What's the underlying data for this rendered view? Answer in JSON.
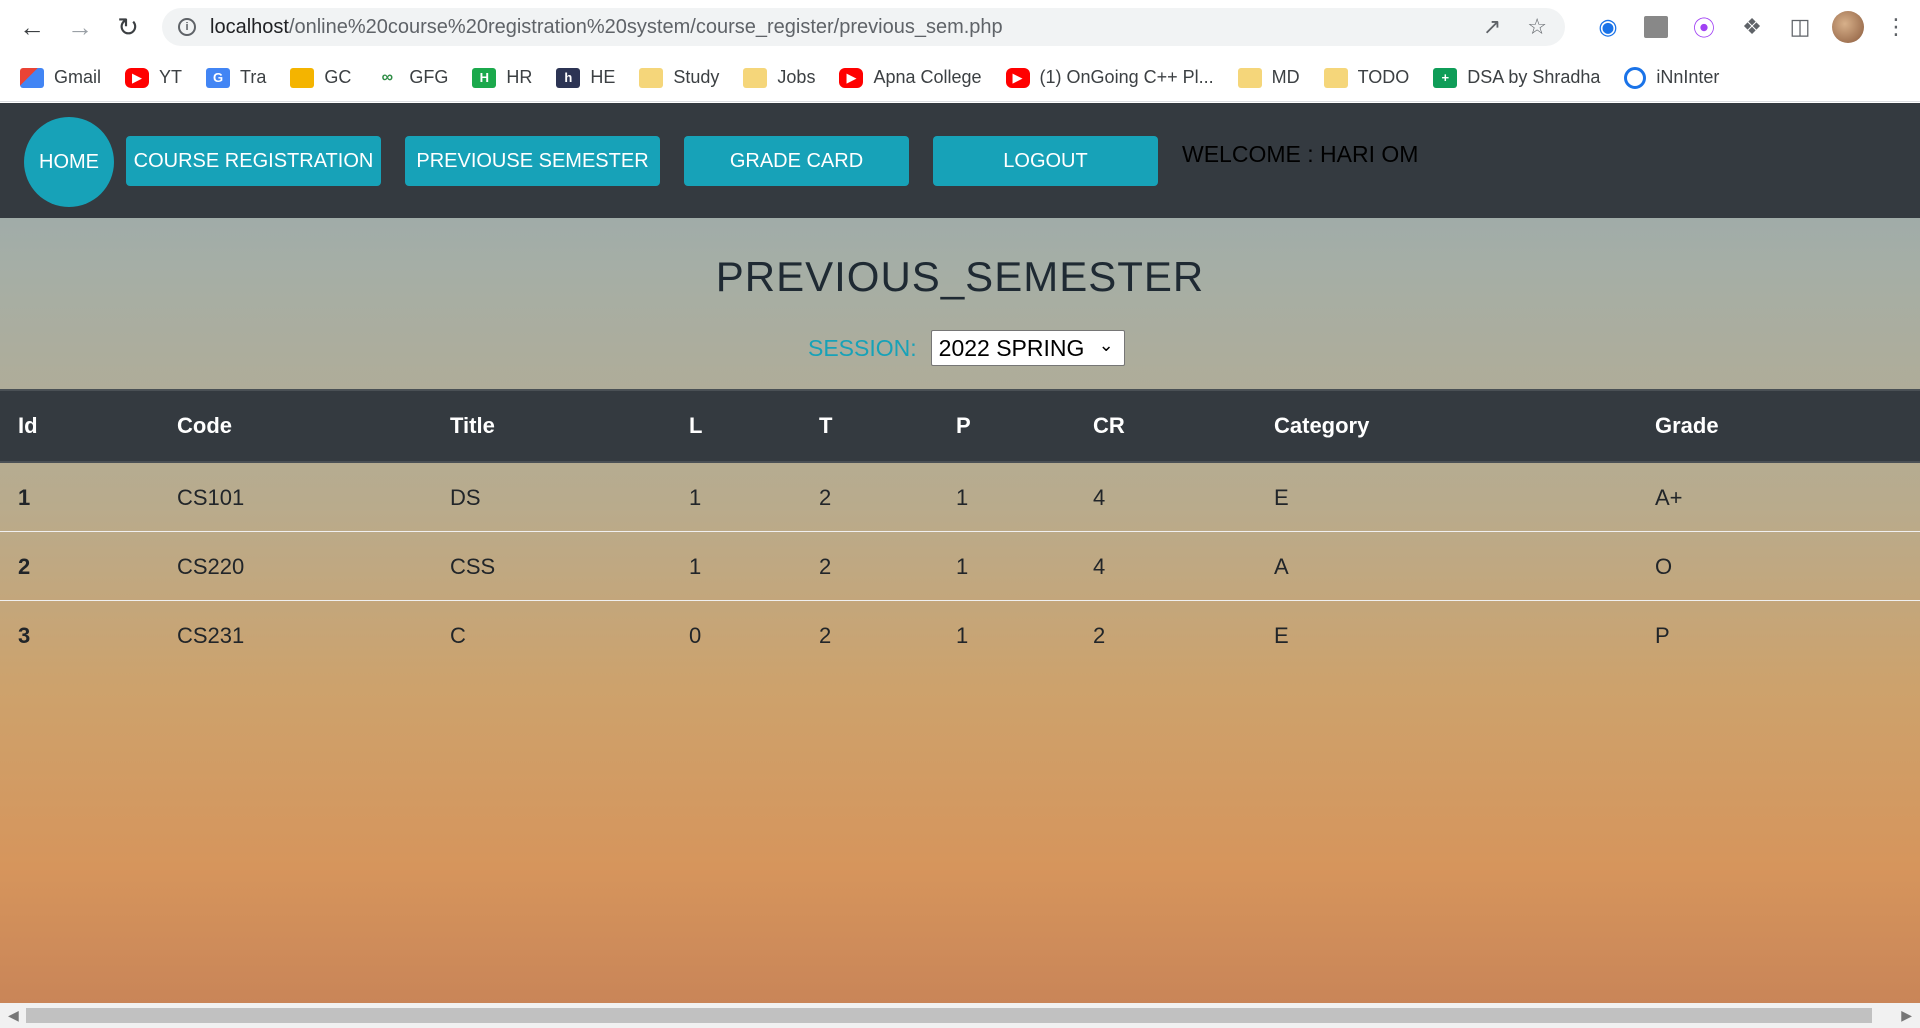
{
  "browser": {
    "url_host": "localhost",
    "url_path": "/online%20course%20registration%20system/course_register/previous_sem.php",
    "bookmarks": [
      {
        "label": "Gmail",
        "icon": "gmail-icon"
      },
      {
        "label": "YT",
        "icon": "youtube-icon"
      },
      {
        "label": "Tra",
        "icon": "translate-icon"
      },
      {
        "label": "GC",
        "icon": "classroom-icon"
      },
      {
        "label": "GFG",
        "icon": "gfg-icon"
      },
      {
        "label": "HR",
        "icon": "hackerrank-icon"
      },
      {
        "label": "HE",
        "icon": "hackerearth-icon"
      },
      {
        "label": "Study",
        "icon": "folder-icon"
      },
      {
        "label": "Jobs",
        "icon": "folder-icon"
      },
      {
        "label": "Apna College",
        "icon": "youtube-icon"
      },
      {
        "label": "(1) OnGoing C++ Pl...",
        "icon": "youtube-icon"
      },
      {
        "label": "MD",
        "icon": "folder-icon"
      },
      {
        "label": "TODO",
        "icon": "folder-icon"
      },
      {
        "label": "DSA by Shradha",
        "icon": "sheets-icon"
      },
      {
        "label": "iNnInter",
        "icon": "innerview-icon"
      }
    ]
  },
  "nav": {
    "home": "HOME",
    "course_registration": "COURSE REGISTRATION",
    "previous_semester": "PREVIOUSE SEMESTER",
    "grade_card": "GRADE CARD",
    "logout": "LOGOUT",
    "welcome": "WELCOME : HARI OM"
  },
  "main": {
    "title": "PREVIOUS_SEMESTER",
    "session_label": "SESSION:",
    "session_value": "2022 SPRING"
  },
  "table": {
    "headers": [
      "Id",
      "Code",
      "Title",
      "L",
      "T",
      "P",
      "CR",
      "Category",
      "Grade"
    ],
    "rows": [
      [
        "1",
        "CS101",
        "DS",
        "1",
        "2",
        "1",
        "4",
        "E",
        "A+"
      ],
      [
        "2",
        "CS220",
        "CSS",
        "1",
        "2",
        "1",
        "4",
        "A",
        "O"
      ],
      [
        "3",
        "CS231",
        "C",
        "0",
        "2",
        "1",
        "2",
        "E",
        "P"
      ]
    ]
  },
  "colors": {
    "nav_bg": "#343a40",
    "accent": "#17a2b8"
  }
}
